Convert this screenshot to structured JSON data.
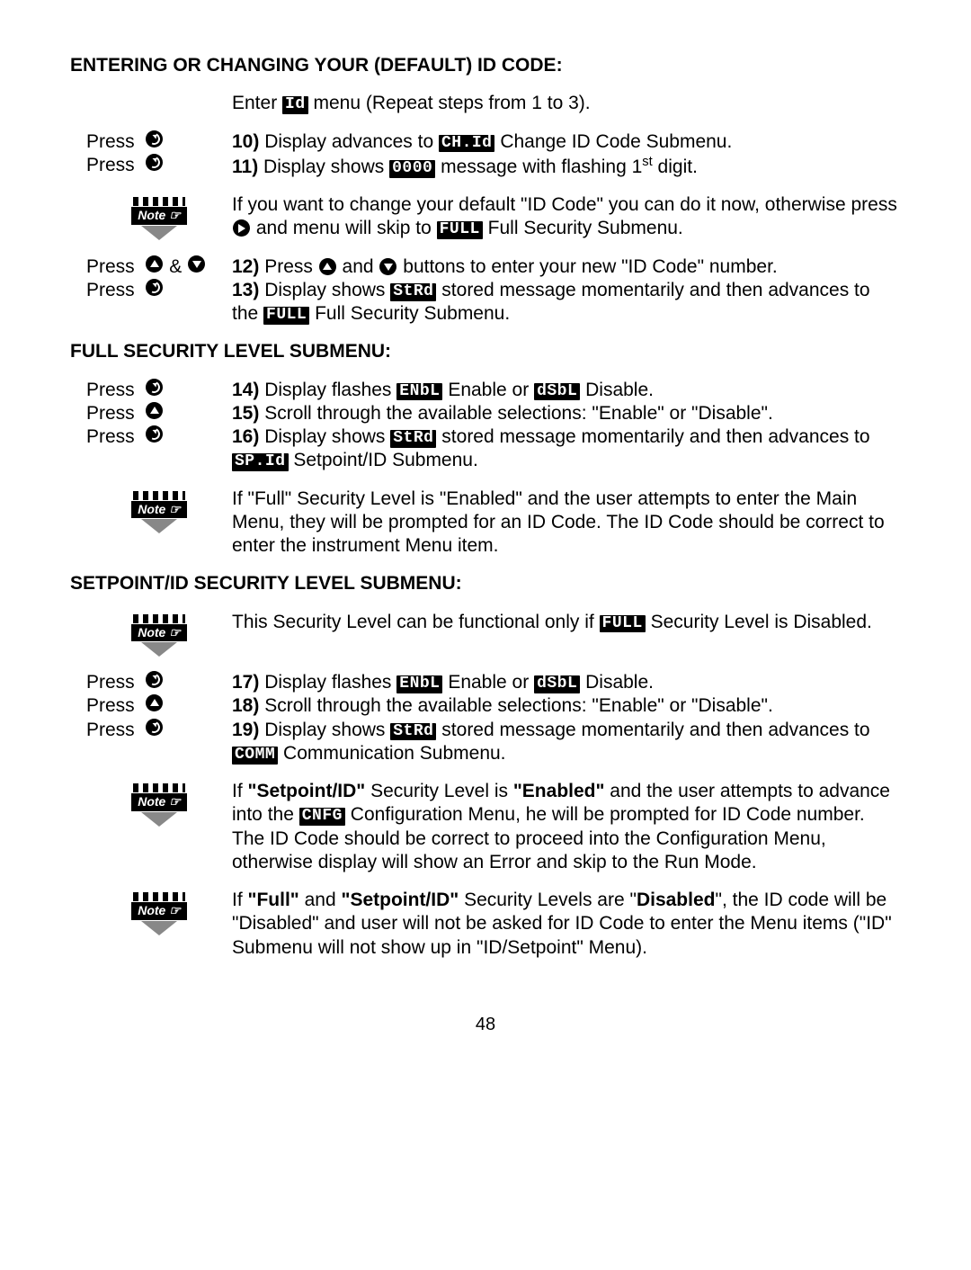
{
  "headings": {
    "h1": "ENTERING OR CHANGING YOUR (DEFAULT) ID CODE:",
    "h2": "FULL SECURITY LEVEL SUBMENU:",
    "h3": "SETPOINT/ID SECURITY LEVEL SUBMENU:"
  },
  "labels": {
    "press": "Press",
    "enter": "Enter",
    "amp": "&",
    "note": "Note ☞"
  },
  "badges": {
    "id": "Id",
    "chid": "CH.Id",
    "zeros": "0000",
    "full": "FULL",
    "strd": "StRd",
    "enbl": "ENbL",
    "dsbl": "dSbL",
    "spid": "SP.Id",
    "comm": "COMM",
    "cnfg": "CNFG"
  },
  "intro": {
    "pre": " menu (Repeat steps from 1 to 3)."
  },
  "steps": {
    "s10": {
      "n": "10)",
      "pre": " Display advances to ",
      "post": " Change ID Code Submenu."
    },
    "s11": {
      "n": "11)",
      "pre": " Display shows ",
      "mid": " message with flashing 1",
      "sup": "st",
      "post": " digit."
    },
    "note1": {
      "a": "If you want to change your default \"ID Code\" you can do it now, otherwise press ",
      "b": " and menu will skip to ",
      "c": " Full Security Submenu."
    },
    "s12": {
      "n": "12)",
      "a": " Press ",
      "b": " and ",
      "c": " buttons to enter your new \"ID Code\" number."
    },
    "s13": {
      "n": "13)",
      "a": " Display shows ",
      "b": " stored message momentarily and then advances to the ",
      "c": " Full Security Submenu."
    },
    "s14": {
      "n": "14)",
      "a": " Display flashes ",
      "b": " Enable or ",
      "c": " Disable."
    },
    "s15": {
      "n": "15)",
      "a": " Scroll through the available selections: \"Enable\" or \"Disable\"."
    },
    "s16": {
      "n": "16)",
      "a": " Display shows ",
      "b": " stored message momentarily and then advances to ",
      "c": " Setpoint/ID Submenu."
    },
    "note2": "If \"Full\" Security Level is \"Enabled\" and the user attempts to enter the Main Menu, they will be prompted for an ID Code. The ID Code should be correct to enter the instrument Menu item.",
    "note3": {
      "a": "This Security Level can be functional only if ",
      "b": " Security Level is Disabled."
    },
    "s17": {
      "n": "17)",
      "a": " Display flashes ",
      "b": " Enable or ",
      "c": " Disable."
    },
    "s18": {
      "n": "18)",
      "a": " Scroll through the available selections: \"Enable\" or \"Disable\"."
    },
    "s19": {
      "n": "19)",
      "a": " Display shows ",
      "b": " stored message momentarily and then advances to ",
      "c": " Communication Submenu."
    },
    "note4": {
      "a": "If ",
      "b": "\"Setpoint/ID\"",
      "c": " Security Level is ",
      "d": "\"Enabled\"",
      "e": " and the user attempts to advance into the ",
      "f": " Configuration Menu, he will be prompted for ID Code number. The ID Code should be correct to proceed into the Configuration Menu, otherwise display will show an Error and skip to the Run Mode."
    },
    "note5": {
      "a": "If ",
      "b": "\"Full\"",
      "c": " and ",
      "d": "\"Setpoint/ID\"",
      "e": " Security Levels are \"",
      "f": "Disabled",
      "g": "\", the ID code will be \"Disabled\" and user will not be asked for ID Code to enter the Menu items (\"ID\" Submenu will not show up in \"ID/Setpoint\" Menu)."
    }
  },
  "page": "48"
}
